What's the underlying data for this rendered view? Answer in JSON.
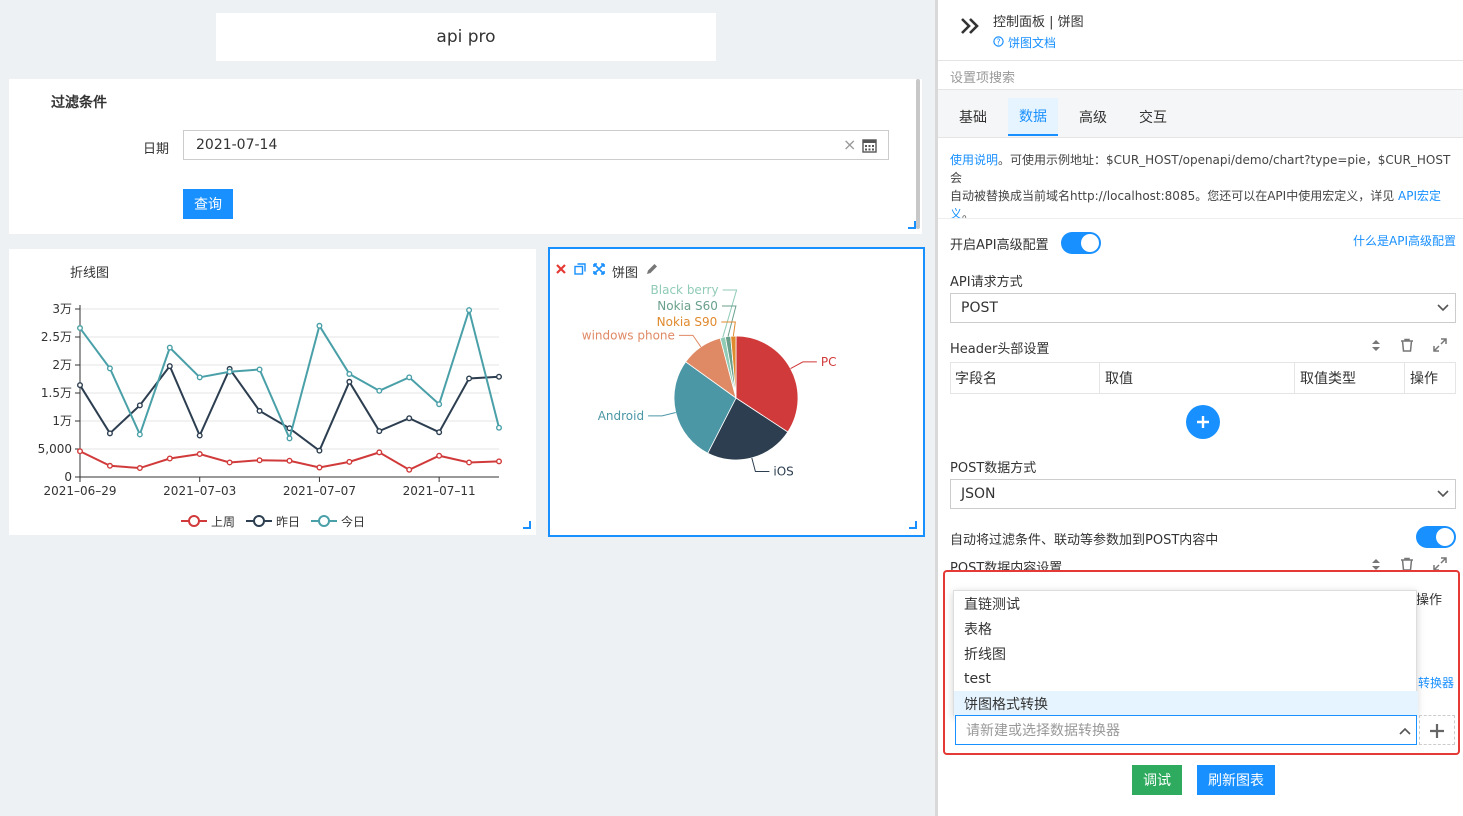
{
  "dashboard": {
    "title": "api pro"
  },
  "filter": {
    "heading": "过滤条件",
    "date_label": "日期",
    "date_value": "2021-07-14",
    "clear_icon": "×",
    "query_button": "查询"
  },
  "line_panel": {
    "title": "折线图"
  },
  "pie_panel": {
    "title": "饼图",
    "tool_icons": [
      "close-icon",
      "copy-icon",
      "fullscreen-icon",
      "edit-icon"
    ]
  },
  "chart_data": [
    {
      "type": "line",
      "x": [
        "2021-06-29",
        "2021-06-30",
        "2021-07-01",
        "2021-07-02",
        "2021-07-03",
        "2021-07-04",
        "2021-07-05",
        "2021-07-06",
        "2021-07-07",
        "2021-07-08",
        "2021-07-09",
        "2021-07-10",
        "2021-07-11",
        "2021-07-12",
        "2021-07-13"
      ],
      "x_tick_labels": [
        "2021–06–29",
        "2021–07–03",
        "2021–07–07",
        "2021–07–11"
      ],
      "y_tick_labels": [
        "0",
        "5,000",
        "1万",
        "1.5万",
        "2万",
        "2.5万",
        "3万"
      ],
      "ylim": [
        0,
        30000
      ],
      "grid": true,
      "legend_position": "bottom",
      "series": [
        {
          "name": "上周",
          "color": "#d13a3a",
          "values": [
            4600,
            2000,
            1600,
            3300,
            4100,
            2600,
            3000,
            2900,
            1700,
            2700,
            4400,
            1300,
            3800,
            2600,
            2800
          ]
        },
        {
          "name": "昨日",
          "color": "#2c3e50",
          "values": [
            16400,
            7800,
            12800,
            19800,
            7400,
            19300,
            11800,
            8700,
            4700,
            17000,
            8200,
            10500,
            8000,
            17600,
            17900
          ]
        },
        {
          "name": "今日",
          "color": "#4aa0a8",
          "values": [
            26600,
            19400,
            7600,
            23100,
            17800,
            18800,
            19200,
            6900,
            27000,
            18400,
            15400,
            17800,
            13000,
            29800,
            8800
          ]
        }
      ]
    },
    {
      "type": "pie",
      "slices": [
        {
          "label": "PC",
          "value": 25,
          "color": "#d13a3a"
        },
        {
          "label": "iOS",
          "value": 17,
          "color": "#2c3e50"
        },
        {
          "label": "Android",
          "value": 20,
          "color": "#4c97a6"
        },
        {
          "label": "windows phone",
          "value": 8,
          "color": "#e08a65"
        },
        {
          "label": "Black berry",
          "value": 1,
          "color": "#8fcbb5"
        },
        {
          "label": "Nokia S60",
          "value": 1,
          "color": "#6aa08b"
        },
        {
          "label": "Nokia S90",
          "value": 1,
          "color": "#e08a2e"
        }
      ]
    }
  ],
  "right_panel": {
    "breadcrumb": "控制面板 | 饼图",
    "doc_link": "饼图文档",
    "search_placeholder": "设置项搜索",
    "tabs": [
      "基础",
      "数据",
      "高级",
      "交互"
    ],
    "active_tab": "数据",
    "help_line1_link": "使用说明",
    "help_line1_text": "。可使用示例地址：$CUR_HOST/openapi/demo/chart?type=pie，$CUR_HOST会",
    "help_line2_text": "自动被替换成当前域名http://localhost:8085。您还可以在API中使用宏定义，详见 ",
    "help_line2_link": "API宏定",
    "help_line3_link": "义",
    "help_line3_text": "。",
    "adv_config_label": "开启API高级配置",
    "adv_config_link": "什么是API高级配置",
    "method_label": "API请求方式",
    "method_value": "POST",
    "header_label": "Header头部设置",
    "header_columns": [
      "字段名",
      "取值",
      "取值类型",
      "操作"
    ],
    "post_mode_label": "POST数据方式",
    "post_mode_value": "JSON",
    "auto_merge_label": "自动将过滤条件、联动等参数加到POST内容中",
    "post_content_label": "POST数据内容设置",
    "post_content_op": "操作",
    "converter_link_fragment": "转换器",
    "dropdown_options": [
      "直链测试",
      "表格",
      "折线图",
      "test",
      "饼图格式转换"
    ],
    "dropdown_highlighted": "饼图格式转换",
    "converter_placeholder": "请新建或选择数据转换器",
    "debug_button": "调试",
    "refresh_button": "刷新图表",
    "colors": {
      "accent": "#1890ff",
      "debug": "#2eab5e",
      "highlight_border": "#e53935"
    }
  }
}
